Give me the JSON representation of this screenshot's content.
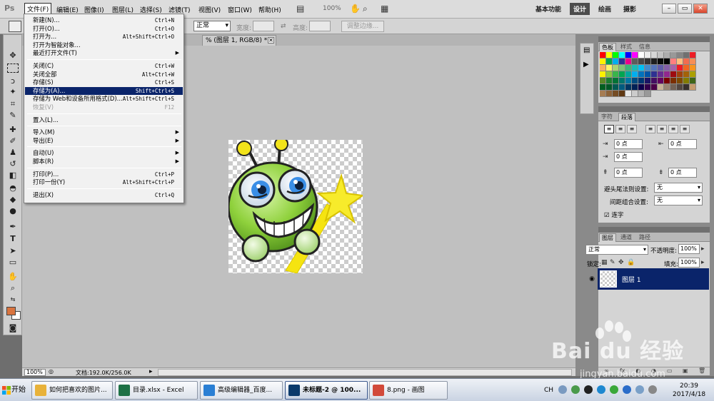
{
  "app": {
    "logo": "Ps",
    "menus": [
      "文件(F)",
      "编辑(E)",
      "图像(I)",
      "图层(L)",
      "选择(S)",
      "滤镜(T)",
      "视图(V)",
      "窗口(W)",
      "帮助(H)"
    ],
    "zoom": "100%",
    "workspaces": [
      "基本功能",
      "设计",
      "绘画",
      "摄影"
    ],
    "active_workspace": "设计",
    "window_buttons": [
      "–",
      "▭",
      "✕"
    ]
  },
  "options_bar": {
    "style_value": "正常",
    "width_label": "宽度:",
    "height_label": "高度:",
    "refine_edge": "调整边缘..."
  },
  "document": {
    "tab_title": "% (图层 1, RGB/8) *",
    "zoom_field": "100%",
    "doc_info": "文档:192.0K/256.0K"
  },
  "file_menu": {
    "items": [
      {
        "label": "新建(N)...",
        "shortcut": "Ctrl+N"
      },
      {
        "label": "打开(O)...",
        "shortcut": "Ctrl+O"
      },
      {
        "label": "打开为...",
        "shortcut": "Alt+Shift+Ctrl+O"
      },
      {
        "label": "打开为智能对象...",
        "shortcut": ""
      },
      {
        "label": "最近打开文件(T)",
        "shortcut": "",
        "submenu": true
      },
      {
        "label": "关闭(C)",
        "shortcut": "Ctrl+W"
      },
      {
        "label": "关闭全部",
        "shortcut": "Alt+Ctrl+W"
      },
      {
        "label": "存储(S)",
        "shortcut": "Ctrl+S"
      },
      {
        "label": "存储为(A)...",
        "shortcut": "Shift+Ctrl+S",
        "highlighted": true
      },
      {
        "label": "存储为 Web和设备所用格式(D)...",
        "shortcut": "Alt+Shift+Ctrl+S"
      },
      {
        "label": "恢复(V)",
        "shortcut": "F12",
        "disabled": true
      },
      {
        "label": "置入(L)...",
        "shortcut": ""
      },
      {
        "label": "导入(M)",
        "shortcut": "",
        "submenu": true
      },
      {
        "label": "导出(E)",
        "shortcut": "",
        "submenu": true
      },
      {
        "label": "自动(U)",
        "shortcut": "",
        "submenu": true
      },
      {
        "label": "脚本(R)",
        "shortcut": "",
        "submenu": true
      },
      {
        "label": "打印(P)...",
        "shortcut": "Ctrl+P"
      },
      {
        "label": "打印一份(Y)",
        "shortcut": "Alt+Shift+Ctrl+P"
      },
      {
        "label": "退出(X)",
        "shortcut": "Ctrl+Q"
      }
    ]
  },
  "swatches_panel": {
    "tabs": [
      "色板",
      "样式",
      "信息"
    ],
    "active_tab": "色板"
  },
  "paragraph_panel": {
    "tabs": [
      "字符",
      "段落"
    ],
    "active_tab": "段落",
    "indent_left": "0 点",
    "indent_right": "0 点",
    "indent_first": "0 点",
    "space_before": "0 点",
    "space_after": "0 点",
    "hyphen_label": "避头尾法则设置:",
    "hyphen_value": "无",
    "spacing_label": "间距组合设置:",
    "spacing_value": "无",
    "hyphenate_label": "连字"
  },
  "layers_panel": {
    "tabs": [
      "图层",
      "通道",
      "路径"
    ],
    "active_tab": "图层",
    "blend_mode": "正常",
    "opacity_label": "不透明度:",
    "opacity_value": "100%",
    "lock_label": "锁定:",
    "fill_label": "填充:",
    "fill_value": "100%",
    "layer_name": "图层 1"
  },
  "watermark": {
    "brand": "Bai du 经验",
    "site": "jingyan.baidu.com"
  },
  "taskbar": {
    "start_label": "开始",
    "tasks": [
      {
        "label": "如何把喜欢的图片...",
        "icon": "folder-icon",
        "color": "#e8b23a"
      },
      {
        "label": "目录.xlsx - Excel",
        "icon": "excel-icon",
        "color": "#1e7145"
      },
      {
        "label": "高级编辑器_百度...",
        "icon": "ie-icon",
        "color": "#2a7fd4"
      },
      {
        "label": "未标题-2 @ 100...",
        "icon": "photoshop-icon",
        "color": "#0b3a6b",
        "active": true
      },
      {
        "label": "8.png - 画图",
        "icon": "paint-icon",
        "color": "#d24a3a"
      }
    ],
    "ime": "CH",
    "time": "20:39",
    "date": "2017/4/18"
  },
  "colors": {
    "menu_highlight": "#0a246a",
    "foreground": "#d9743f",
    "background": "#ffffff"
  }
}
